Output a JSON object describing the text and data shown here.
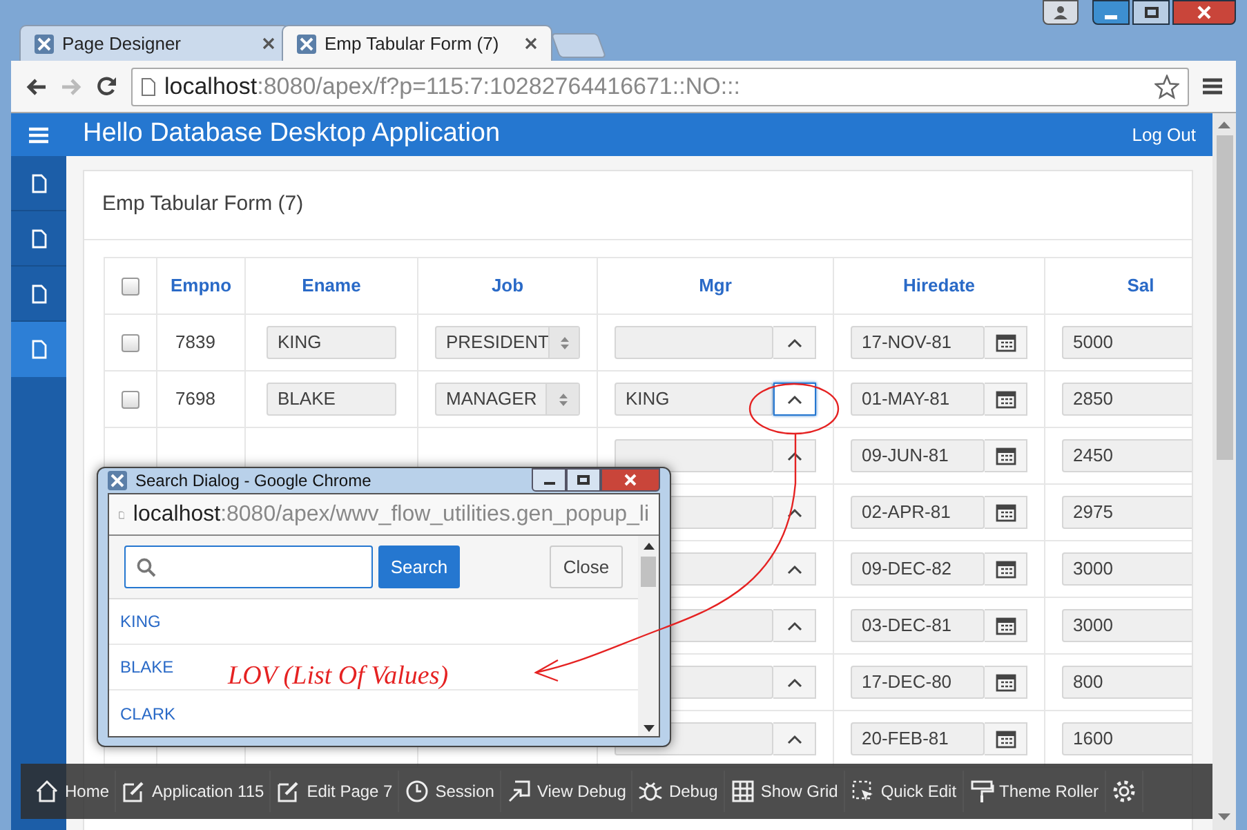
{
  "browser": {
    "tabs": [
      {
        "title": "Page Designer",
        "selected": false
      },
      {
        "title": "Emp Tabular Form (7)",
        "selected": true
      }
    ],
    "url_host": "localhost",
    "url_rest": ":8080/apex/f?p=115:7:10282764416671::NO:::"
  },
  "app": {
    "title": "Hello Database Desktop Application",
    "logout": "Log Out",
    "nav": [
      {
        "selected": false
      },
      {
        "selected": false
      },
      {
        "selected": false
      },
      {
        "selected": true
      }
    ]
  },
  "region_title": "Emp Tabular Form (7)",
  "table": {
    "columns": [
      "Empno",
      "Ename",
      "Job",
      "Mgr",
      "Hiredate",
      "Sal"
    ],
    "select_all_checked": false,
    "rows": [
      {
        "checked": false,
        "empno": "7839",
        "ename": "KING",
        "job": "PRESIDENT",
        "hiredate": "17-NOV-81",
        "sal": "5000",
        "mgr_focused": false
      },
      {
        "checked": false,
        "empno": "7698",
        "ename": "BLAKE",
        "job": "MANAGER",
        "mgr": "KING",
        "hiredate": "01-MAY-81",
        "sal": "2850",
        "mgr_focused": true
      },
      {
        "hiredate": "09-JUN-81",
        "sal": "2450",
        "mgr_focused": false
      },
      {
        "hiredate": "02-APR-81",
        "sal": "2975",
        "mgr_focused": false
      },
      {
        "hiredate": "09-DEC-82",
        "sal": "3000",
        "mgr_focused": false
      },
      {
        "hiredate": "03-DEC-81",
        "sal": "3000",
        "mgr_focused": false
      },
      {
        "hiredate": "17-DEC-80",
        "sal": "800",
        "mgr_focused": false
      },
      {
        "hiredate": "20-FEB-81",
        "sal": "1600",
        "mgr_focused": false
      }
    ]
  },
  "dialog": {
    "title": "Search Dialog - Google Chrome",
    "url_host": "localhost",
    "url_rest": ":8080/apex/wwv_flow_utilities.gen_popup_li",
    "search_button": "Search",
    "close_button": "Close",
    "items": [
      "KING",
      "BLAKE",
      "CLARK"
    ]
  },
  "annotation": {
    "text": "LOV (List Of Values)"
  },
  "dev_toolbar": [
    {
      "kind": "home",
      "label": "Home"
    },
    {
      "kind": "edit",
      "label": "Application 115"
    },
    {
      "kind": "edit",
      "label": "Edit Page 7"
    },
    {
      "kind": "clock",
      "label": "Session"
    },
    {
      "kind": "popout",
      "label": "View Debug"
    },
    {
      "kind": "bug",
      "label": "Debug"
    },
    {
      "kind": "grid",
      "label": "Show Grid"
    },
    {
      "kind": "cursor",
      "label": "Quick Edit"
    },
    {
      "kind": "roller",
      "label": "Theme Roller"
    },
    {
      "kind": "settings"
    }
  ]
}
